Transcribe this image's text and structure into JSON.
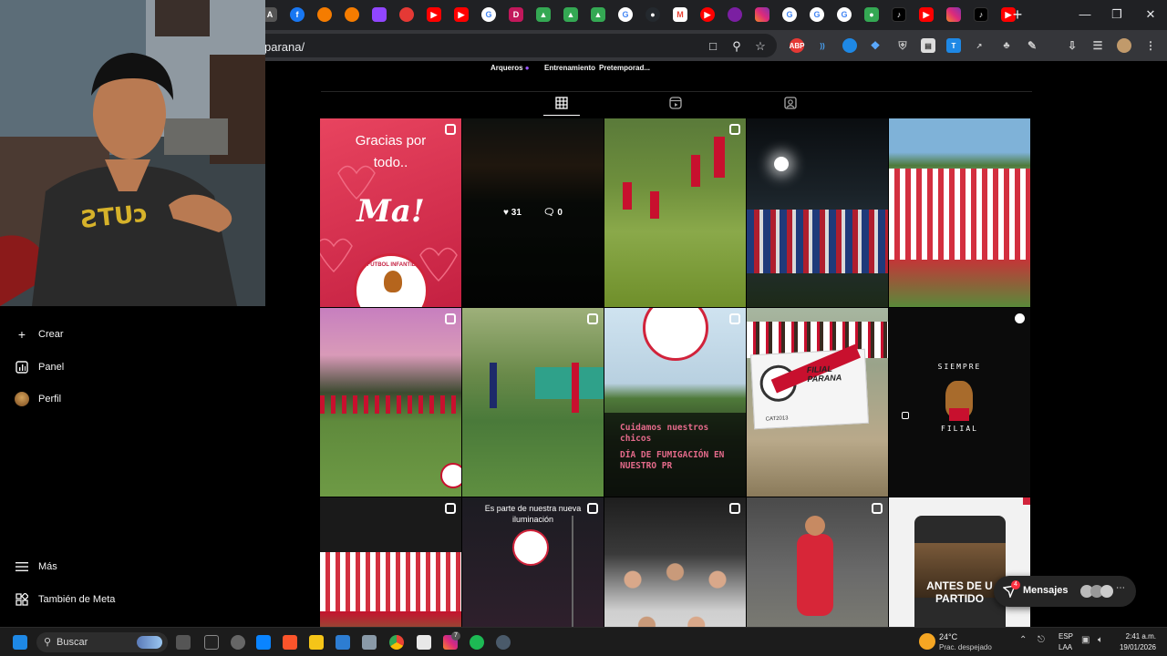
{
  "browser": {
    "url": "parana/",
    "tab_icons": [
      "facebook-icon",
      "orange-icon",
      "twitch-icon",
      "red-icon",
      "youtube-icon",
      "youtube-icon",
      "google-icon",
      "d-icon",
      "drive-icon",
      "drive-icon",
      "drive-icon",
      "google-icon",
      "github-icon",
      "gmail-icon",
      "youtube-icon",
      "purple-icon",
      "instagram-icon",
      "google-icon",
      "google-icon",
      "google-icon",
      "maps-icon",
      "tiktok-icon",
      "youtube-icon",
      "instagram-icon",
      "tiktok-icon",
      "youtube-icon"
    ],
    "extension_labels": [
      "ABP",
      "T"
    ]
  },
  "profile": {
    "highlights": [
      "Arqueros",
      "Entrenamiento",
      "Pretemporad..."
    ]
  },
  "sidebar": {
    "items": [
      {
        "label": "Crear",
        "icon": "plus-icon"
      },
      {
        "label": "Panel",
        "icon": "chart-icon"
      },
      {
        "label": "Perfil",
        "icon": "avatar-icon"
      },
      {
        "label": "Más",
        "icon": "menu-icon"
      },
      {
        "label": "También de Meta",
        "icon": "meta-icon"
      }
    ]
  },
  "grid": {
    "post1": {
      "line1": "Gracias por",
      "line2": "todo..",
      "line3": "Ma!",
      "badge": "FUTBOL INFANTIL"
    },
    "post2": {
      "likes": "31",
      "comments": "0"
    },
    "post8": {
      "line1": "Cuidamos nuestros",
      "line2": "chicos",
      "line3": "DÍA DE FUMIGACIÓN EN",
      "line4": "NUESTRO PR"
    },
    "post9": {
      "banner": "FILIAL PARANA",
      "sub": "CAT2013"
    },
    "post10": {
      "top": "SIEMPRE",
      "bottom": "FILIAL"
    },
    "post12": {
      "line1": "Es parte de nuestra nueva",
      "line2": "iluminación"
    },
    "post15": {
      "line1": "ANTES DE U",
      "line2": "PARTIDO"
    }
  },
  "messages": {
    "label": "Mensajes",
    "count": "4"
  },
  "taskbar": {
    "search_placeholder": "Buscar",
    "weather_temp": "24°C",
    "weather_desc": "Prac. despejado",
    "lang1": "ESP",
    "lang2": "LAA",
    "time": "2:41 a.m.",
    "date": "19/01/2026",
    "badge": "7"
  },
  "colors": {
    "accent_red": "#e2334a",
    "ig_bg": "#000000",
    "chrome_dark": "#202124"
  }
}
